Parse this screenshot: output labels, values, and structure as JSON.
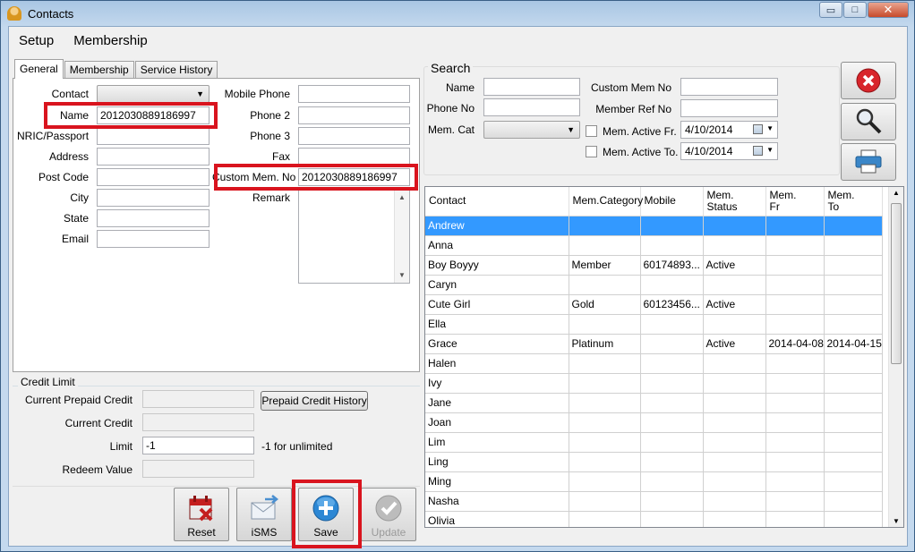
{
  "window": {
    "title": "Contacts",
    "controls": {
      "minimize": "▭",
      "maximize": "□",
      "close": "✕"
    }
  },
  "menu": [
    "Setup",
    "Membership"
  ],
  "tabs": [
    "General",
    "Membership",
    "Service History"
  ],
  "general": {
    "contact_label": "Contact",
    "name_label": "Name",
    "name_value": "201203088918699​7",
    "nric_label": "NRIC/Passport",
    "address_label": "Address",
    "postcode_label": "Post Code",
    "city_label": "City",
    "state_label": "State",
    "email_label": "Email",
    "mobile_label": "Mobile Phone",
    "phone2_label": "Phone 2",
    "phone3_label": "Phone 3",
    "fax_label": "Fax",
    "custom_mem_label": "Custom Mem. No",
    "custom_mem_value": "2012030889186997",
    "remark_label": "Remark"
  },
  "credit": {
    "group_title": "Credit Limit",
    "current_prepaid_label": "Current Prepaid Credit",
    "prepaid_history_button": "Prepaid Credit History",
    "current_credit_label": "Current Credit",
    "limit_label": "Limit",
    "limit_value": "-1",
    "limit_hint": "-1 for unlimited",
    "redeem_label": "Redeem Value"
  },
  "actions": {
    "reset": "Reset",
    "isms": "iSMS",
    "save": "Save",
    "update": "Update"
  },
  "search": {
    "group_title": "Search",
    "name_label": "Name",
    "phone_label": "Phone No",
    "memcat_label": "Mem. Cat",
    "custom_mem_label": "Custom Mem No",
    "member_ref_label": "Member Ref No",
    "active_fr_label": "Mem. Active Fr.",
    "active_fr_value": "4/10/2014",
    "active_to_label": "Mem. Active To.",
    "active_to_value": "4/10/2014"
  },
  "grid": {
    "columns": [
      "Contact",
      "Mem.Category",
      "Mobile",
      "Mem.\nStatus",
      "Mem.\nFr",
      "Mem.\nTo"
    ],
    "rows": [
      [
        "Andrew",
        "",
        "",
        "",
        "",
        ""
      ],
      [
        "Anna",
        "",
        "",
        "",
        "",
        ""
      ],
      [
        "Boy Boyyy",
        "Member",
        "60174893...",
        "Active",
        "",
        ""
      ],
      [
        "Caryn",
        "",
        "",
        "",
        "",
        ""
      ],
      [
        "Cute Girl",
        "Gold",
        "60123456...",
        "Active",
        "",
        ""
      ],
      [
        "Ella",
        "",
        "",
        "",
        "",
        ""
      ],
      [
        "Grace",
        "Platinum",
        "",
        "Active",
        "2014-04-08",
        "2014-04-15"
      ],
      [
        "Halen",
        "",
        "",
        "",
        "",
        ""
      ],
      [
        "Ivy",
        "",
        "",
        "",
        "",
        ""
      ],
      [
        "Jane",
        "",
        "",
        "",
        "",
        ""
      ],
      [
        "Joan",
        "",
        "",
        "",
        "",
        ""
      ],
      [
        "Lim",
        "",
        "",
        "",
        "",
        ""
      ],
      [
        "Ling",
        "",
        "",
        "",
        "",
        ""
      ],
      [
        "Ming",
        "",
        "",
        "",
        "",
        ""
      ],
      [
        "Nasha",
        "",
        "",
        "",
        "",
        ""
      ],
      [
        "Olivia",
        "",
        "",
        "",
        "",
        ""
      ]
    ],
    "selected_row": 0
  },
  "colors": {
    "highlight": "#d9141e",
    "selection": "#3399ff"
  }
}
